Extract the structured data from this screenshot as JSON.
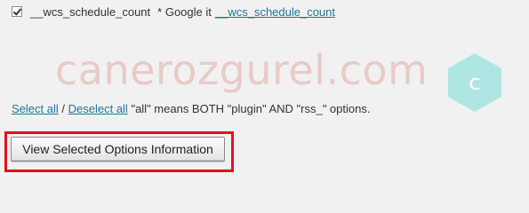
{
  "option": {
    "checked": true,
    "name": "__wcs_schedule_count",
    "hint": "* Google it",
    "google_link": "__wcs_schedule_count"
  },
  "watermark": {
    "text": "canerozgurel.com",
    "badge_letter": "c"
  },
  "selection": {
    "select_all": "Select all",
    "separator": "/",
    "deselect_all": "Deselect all",
    "note": "\"all\" means BOTH \"plugin\" AND \"rss_\" options."
  },
  "action": {
    "button_label": "View Selected Options Information"
  },
  "colors": {
    "link": "#21759b",
    "highlight": "#e3101e",
    "background": "#f1f1f1"
  }
}
